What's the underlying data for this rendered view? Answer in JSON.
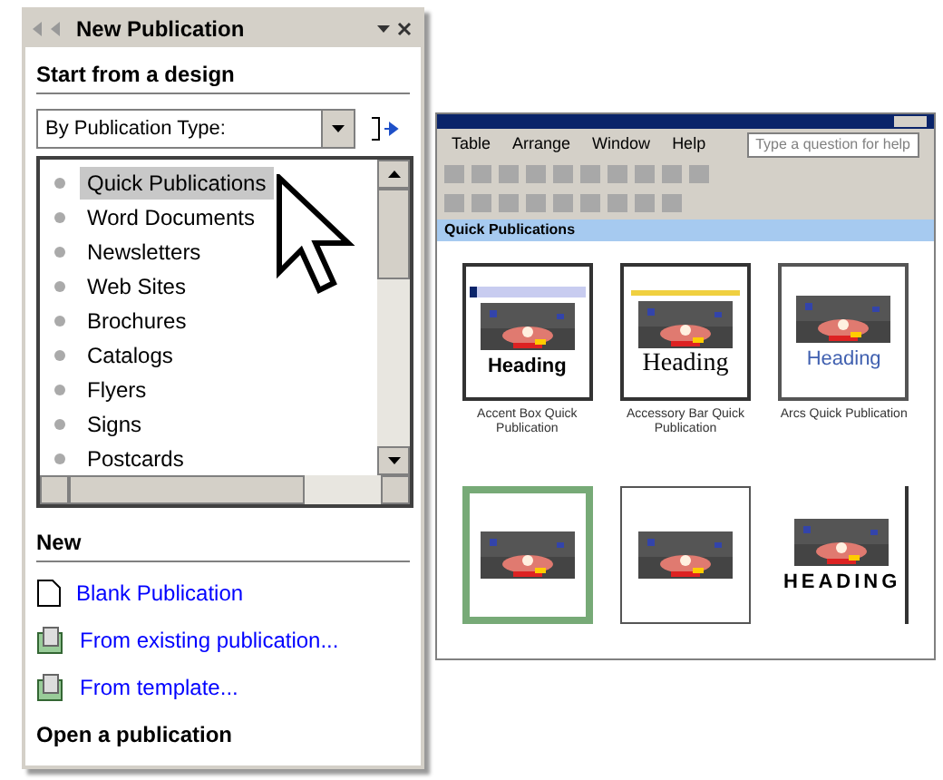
{
  "task_pane": {
    "title": "New Publication",
    "section_design": "Start from a design",
    "dropdown": {
      "value": "By Publication Type:"
    },
    "tree": [
      {
        "label": "Quick Publications",
        "selected": true
      },
      {
        "label": "Word Documents",
        "selected": false
      },
      {
        "label": "Newsletters",
        "selected": false
      },
      {
        "label": "Web Sites",
        "selected": false
      },
      {
        "label": "Brochures",
        "selected": false
      },
      {
        "label": "Catalogs",
        "selected": false
      },
      {
        "label": "Flyers",
        "selected": false
      },
      {
        "label": "Signs",
        "selected": false
      },
      {
        "label": "Postcards",
        "selected": false
      }
    ],
    "section_new": "New",
    "new_links": [
      {
        "label": "Blank Publication",
        "kind": "blank"
      },
      {
        "label": "From existing publication...",
        "kind": "existing"
      },
      {
        "label": "From template...",
        "kind": "template"
      }
    ],
    "section_open": "Open a publication"
  },
  "app_window": {
    "menu": [
      "Table",
      "Arrange",
      "Window",
      "Help"
    ],
    "help_box": {
      "placeholder": "Type a question for help"
    },
    "gallery_title": "Quick Publications",
    "designs": [
      {
        "kind": "accent",
        "heading": "Heading",
        "caption": "Accent Box Quick Publication"
      },
      {
        "kind": "classic",
        "heading": "Heading",
        "caption": "Accessory Bar Quick Publication"
      },
      {
        "kind": "arcs",
        "heading": "Heading",
        "caption": "Arcs Quick Publication"
      },
      {
        "kind": "border"
      },
      {
        "kind": "bubbles"
      },
      {
        "kind": "spaced",
        "heading": "HEADING"
      }
    ]
  }
}
